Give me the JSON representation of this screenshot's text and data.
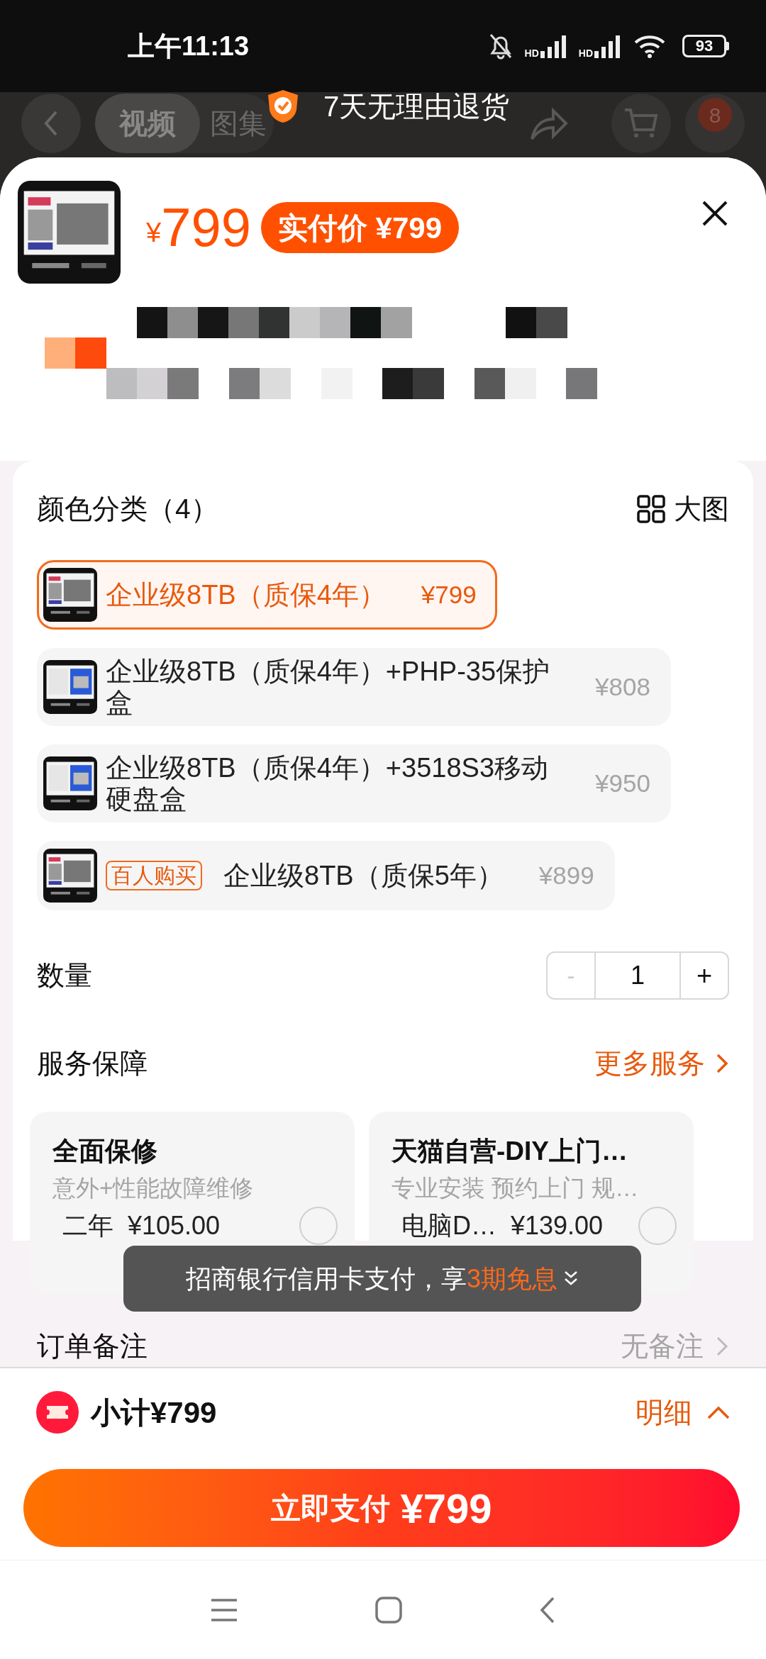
{
  "status_bar": {
    "time": "上午11:13",
    "signal_labels": [
      "HD",
      "HD"
    ],
    "battery": "93"
  },
  "background_nav": {
    "tabs": [
      {
        "label": "视频",
        "selected": true
      },
      {
        "label": "图集",
        "selected": false
      }
    ],
    "cart_badge": "8"
  },
  "banner": {
    "text": "7天无理由退货"
  },
  "header": {
    "currency": "¥",
    "price": "799",
    "pay_badge": "实付价 ¥799"
  },
  "options": {
    "title": "颜色分类（4）",
    "big_view": "大图",
    "items": [
      {
        "name": "企业级8TB（质保4年）",
        "price": "¥799",
        "selected": true
      },
      {
        "name": "企业级8TB（质保4年）+PHP-35保护盒",
        "price": "¥808",
        "selected": false
      },
      {
        "name": "企业级8TB（质保4年）+3518S3移动硬盘盒",
        "price": "¥950",
        "selected": false
      },
      {
        "tag": "百人购买",
        "name": "企业级8TB（质保5年）",
        "price": "¥899",
        "selected": false
      }
    ]
  },
  "quantity": {
    "label": "数量",
    "minus": "-",
    "value": "1",
    "plus": "+",
    "minus_disabled": true
  },
  "services": {
    "title": "服务保障",
    "more": "更多服务",
    "items": [
      {
        "title": "全面保修",
        "subtitle": "意外+性能故障维修",
        "plan": "二年",
        "price": "¥105.00",
        "selected": false
      },
      {
        "title": "天猫自营-DIY上门…",
        "subtitle": "专业安装 预约上门 规…",
        "plan": "电脑D…",
        "price": "¥139.00",
        "selected": false
      }
    ]
  },
  "toast": {
    "text": "招商银行信用卡支付，享",
    "highlight": "3期免息"
  },
  "remark": {
    "label": "订单备注",
    "value": "无备注"
  },
  "footer": {
    "subtotal": "小计¥799",
    "detail": "明细",
    "pay_label": "立即支付",
    "pay_price": "¥799"
  }
}
